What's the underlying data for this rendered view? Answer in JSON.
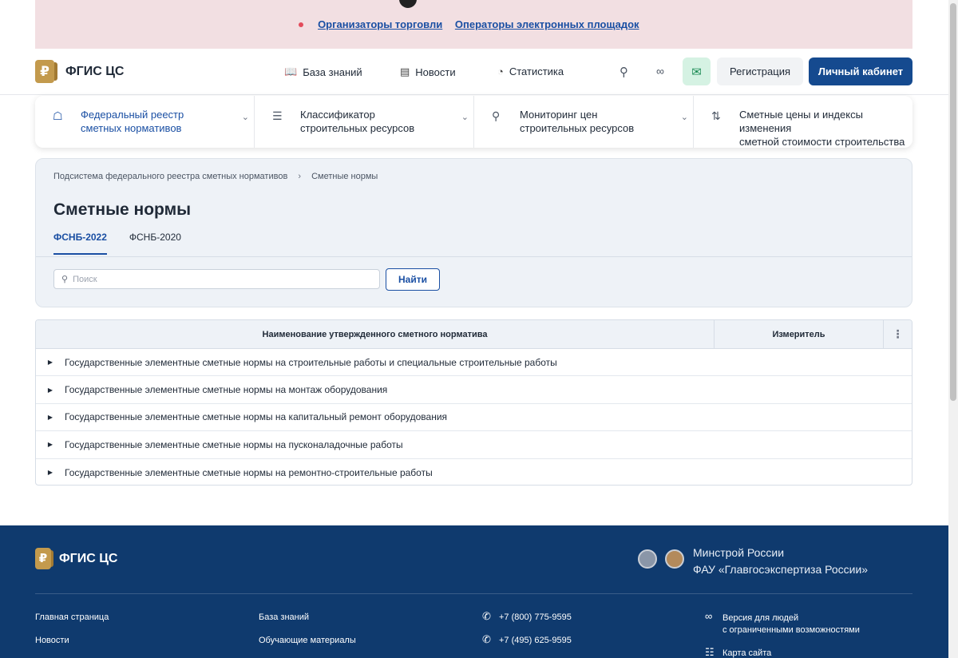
{
  "banner": {
    "link1": "Организаторы торговли",
    "link2": "Операторы электронных площадок"
  },
  "header": {
    "logo_glyph": "₽",
    "logo_text": "ФГИС ЦС",
    "nav": [
      {
        "label": "База знаний",
        "icon": "book-icon"
      },
      {
        "label": "Новости",
        "icon": "newspaper-icon"
      },
      {
        "label": "Статистика",
        "icon": "chart-pie-icon"
      }
    ],
    "register_label": "Регистрация",
    "cabinet_label": "Личный кабинет"
  },
  "services": [
    {
      "line1": "Федеральный реестр",
      "line2": "сметных нормативов",
      "icon": "tag-icon",
      "active": true
    },
    {
      "line1": "Классификатор",
      "line2": "строительных ресурсов",
      "icon": "list-icon",
      "active": false
    },
    {
      "line1": "Мониторинг цен",
      "line2": "строительных ресурсов",
      "icon": "search-icon",
      "active": false
    },
    {
      "line1": "Сметные цены и индексы изменения",
      "line2": "сметной стоимости строительства",
      "icon": "sort-arrows-icon",
      "active": false
    }
  ],
  "breadcrumb": {
    "parent": "Подсистема федерального реестра сметных нормативов",
    "current": "Сметные нормы"
  },
  "page": {
    "title": "Сметные нормы",
    "tabs": [
      "ФСНБ-2022",
      "ФСНБ-2020"
    ],
    "active_tab": "ФСНБ-2022",
    "search_placeholder": "Поиск",
    "find_label": "Найти"
  },
  "table": {
    "col_name": "Наименование утвержденного сметного норматива",
    "col_unit": "Измеритель",
    "rows": [
      "Государственные элементные сметные нормы на строительные работы и специальные строительные работы",
      "Государственные элементные сметные нормы на монтаж оборудования",
      "Государственные элементные сметные нормы на капитальный ремонт оборудования",
      "Государственные элементные сметные нормы на пусконаладочные работы",
      "Государственные элементные сметные нормы на ремонтно-строительные работы"
    ]
  },
  "footer": {
    "logo_text": "ФГИС ЦС",
    "org_line1": "Минстрой России",
    "org_line2": "ФАУ «Главгосэкспертиза России»",
    "col1": [
      "Главная страница",
      "Новости"
    ],
    "col2": [
      "База знаний",
      "Обучающие материалы"
    ],
    "phones": [
      "+7 (800) 775-9595",
      "+7 (495) 625-9595"
    ],
    "accessibility_line1": "Версия для людей",
    "accessibility_line2": "с ограниченными возможностями",
    "sitemap": "Карта сайта"
  },
  "colors": {
    "primary": "#154a8f",
    "link": "#1a4fa3",
    "banner_bg": "#f2dfe2",
    "footer_bg": "#0f3a6e",
    "gold": "#c39a4d"
  }
}
